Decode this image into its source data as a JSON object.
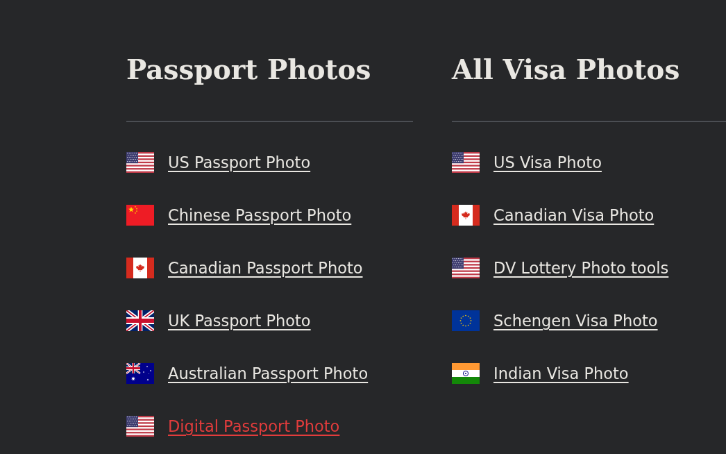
{
  "columns": [
    {
      "heading": "Passport Photos",
      "links": [
        {
          "label": "US Passport Photo",
          "kind": "us",
          "selected": false
        },
        {
          "label": "Chinese Passport Photo",
          "kind": "china",
          "selected": false
        },
        {
          "label": "Canadian Passport Photo",
          "kind": "canada",
          "selected": false
        },
        {
          "label": "UK Passport Photo",
          "kind": "uk",
          "selected": false
        },
        {
          "label": "Australian Passport Photo",
          "kind": "australia",
          "selected": false
        },
        {
          "label": "Digital Passport Photo",
          "kind": "us",
          "selected": true
        }
      ]
    },
    {
      "heading": "All Visa Photos",
      "links": [
        {
          "label": "US Visa Photo",
          "kind": "us",
          "selected": false
        },
        {
          "label": "Canadian Visa Photo",
          "kind": "canada",
          "selected": false
        },
        {
          "label": "DV Lottery Photo tools",
          "kind": "us",
          "selected": false
        },
        {
          "label": "Schengen Visa Photo",
          "kind": "eu",
          "selected": false
        },
        {
          "label": "Indian Visa Photo",
          "kind": "india",
          "selected": false
        }
      ]
    }
  ]
}
